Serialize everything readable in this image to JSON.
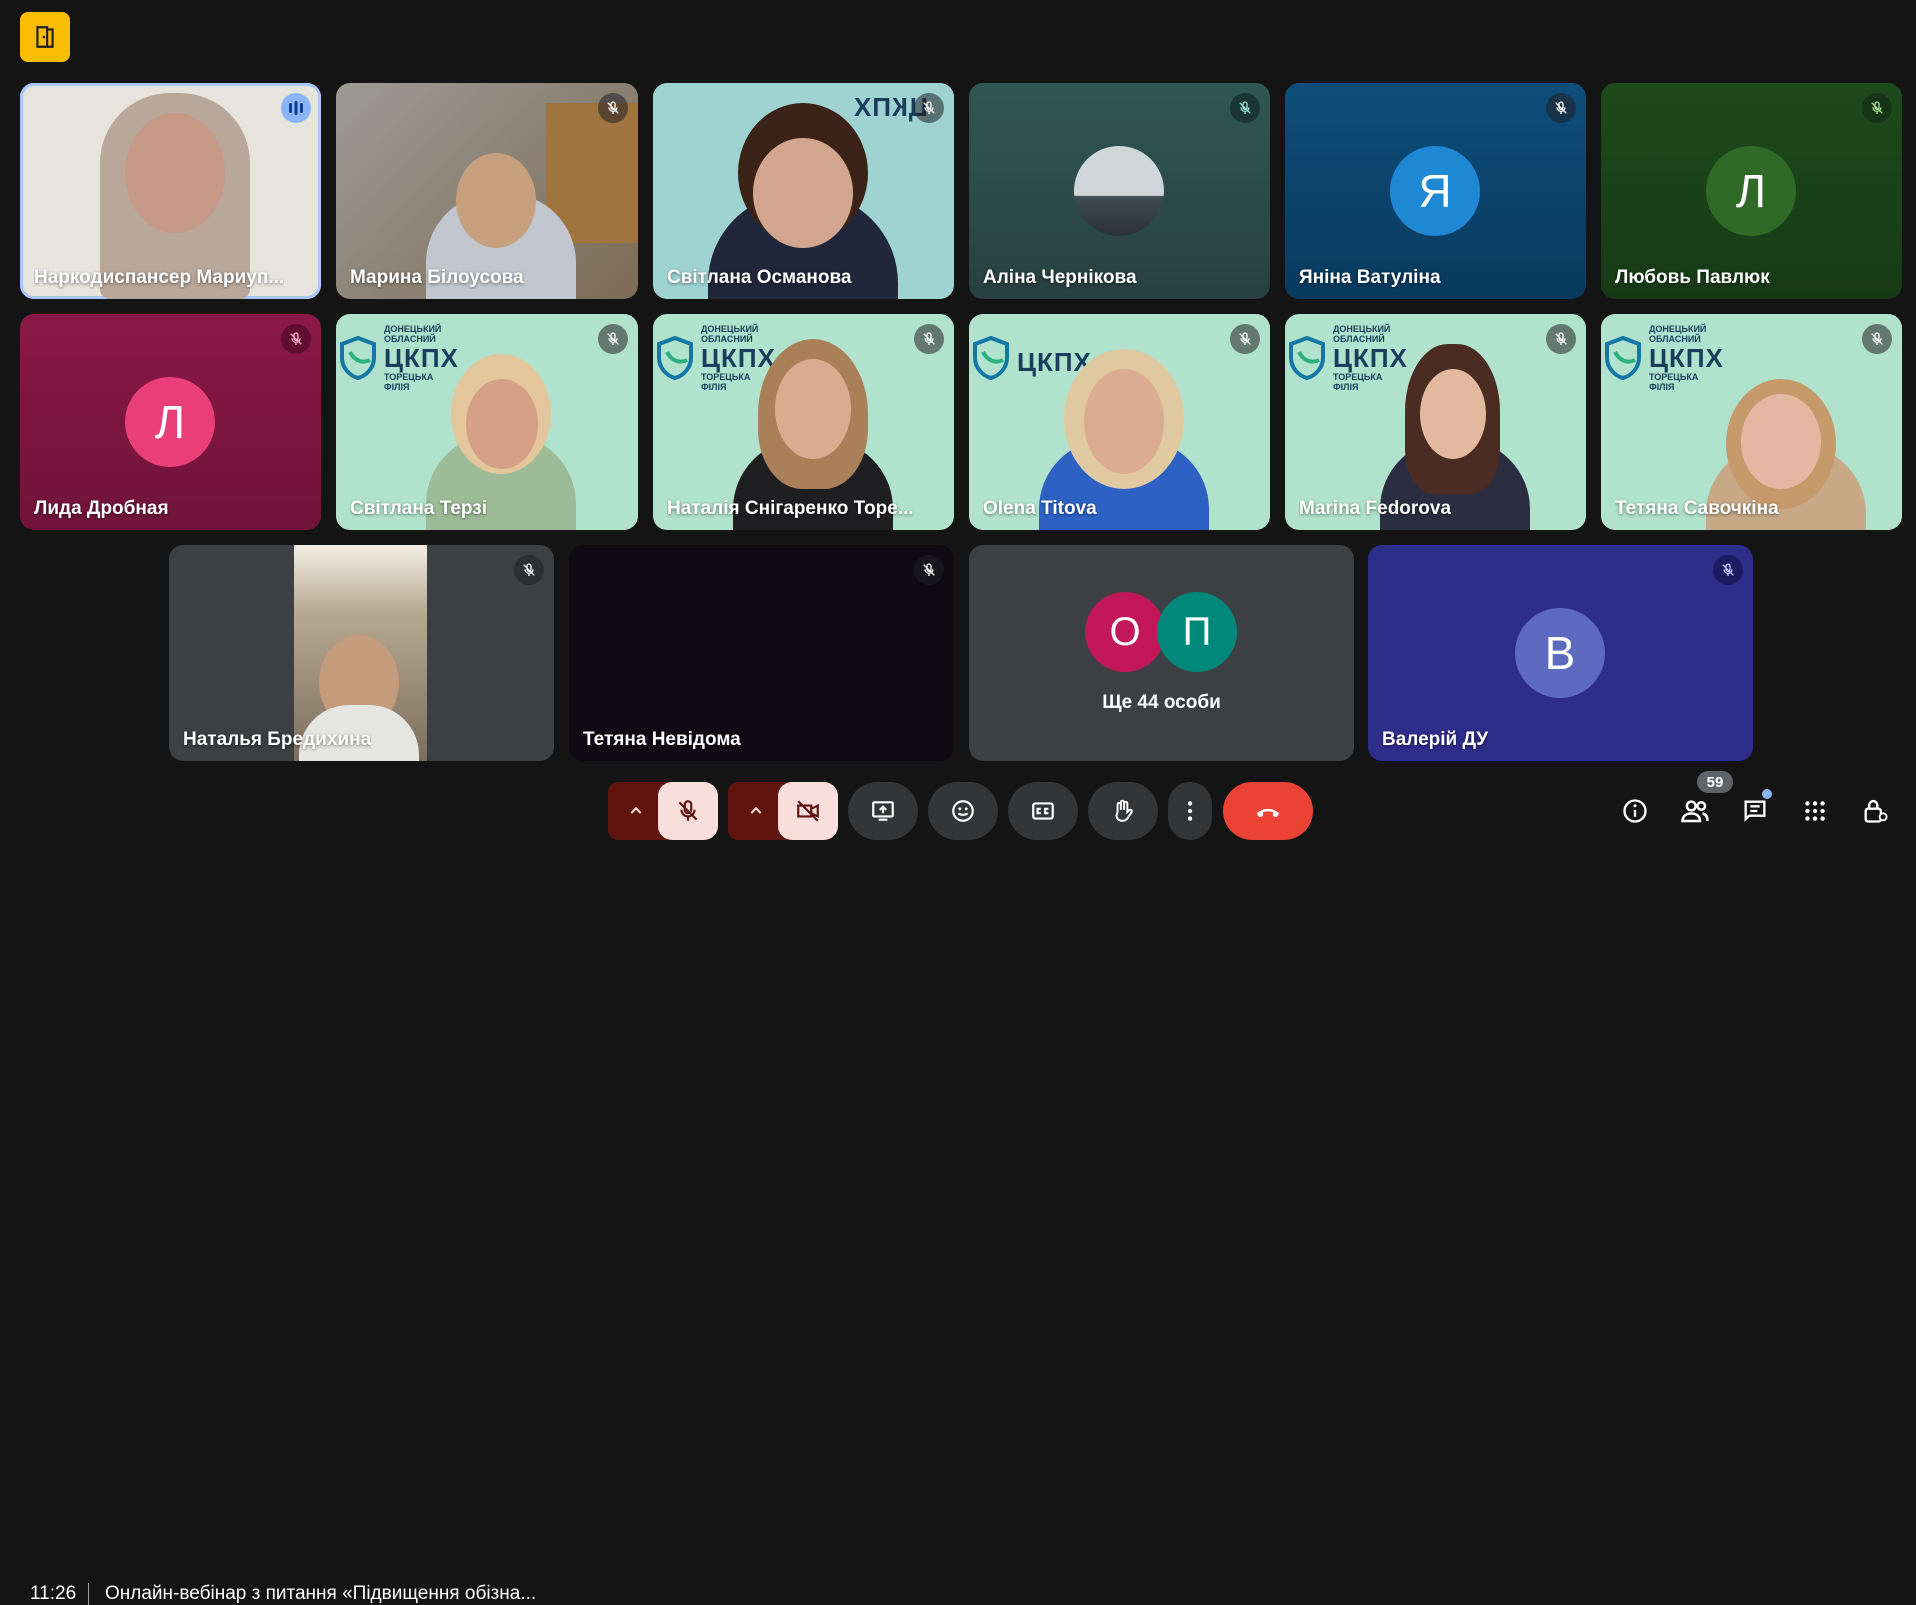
{
  "participants": [
    {
      "name": "Наркодиспансер Мариуп..."
    },
    {
      "name": "Марина Білоусова"
    },
    {
      "name": "Світлана Османова"
    },
    {
      "name": "Аліна Чернікова"
    },
    {
      "name": "Яніна Ватуліна",
      "initial": "Я"
    },
    {
      "name": "Любовь Павлюк",
      "initial": "Л"
    },
    {
      "name": "Лида Дробная",
      "initial": "Л"
    },
    {
      "name": "Світлана Терзі"
    },
    {
      "name": "Наталія Снігаренко Торе..."
    },
    {
      "name": "Olena Titova"
    },
    {
      "name": "Marina Fedorova"
    },
    {
      "name": "Тетяна Савочкіна"
    },
    {
      "name": "Наталья Бредихина"
    },
    {
      "name": "Тетяна Невідома"
    },
    {
      "name": "Валерій ДУ",
      "initial": "В"
    }
  ],
  "others": {
    "initial_1": "О",
    "initial_2": "П",
    "label": "Ще 44 особи"
  },
  "brand": {
    "line1": "ДОНЕЦЬКИЙ",
    "line2": "ОБЛАСНИЙ",
    "big": "ЦКПХ",
    "line3": "ТОРЕЦЬКА",
    "line4": "ФІЛІЯ",
    "mirrored": "ЦКПХ"
  },
  "meeting": {
    "time": "11:26",
    "title": "Онлайн-вебінар з питання «Підвищення обізна..."
  },
  "people_count": "59",
  "colors": {
    "end_call": "#ea4335",
    "muted_btn": "#f9dedc",
    "muted_caret": "#601410",
    "speaking": "#8ab4f8"
  },
  "icons": [
    "door-icon",
    "mic-off-icon",
    "camera-off-icon",
    "present-icon",
    "emoji-icon",
    "captions-icon",
    "raise-hand-icon",
    "more-vert-icon",
    "end-call-icon",
    "info-icon",
    "people-icon",
    "chat-icon",
    "apps-icon",
    "host-controls-icon"
  ]
}
